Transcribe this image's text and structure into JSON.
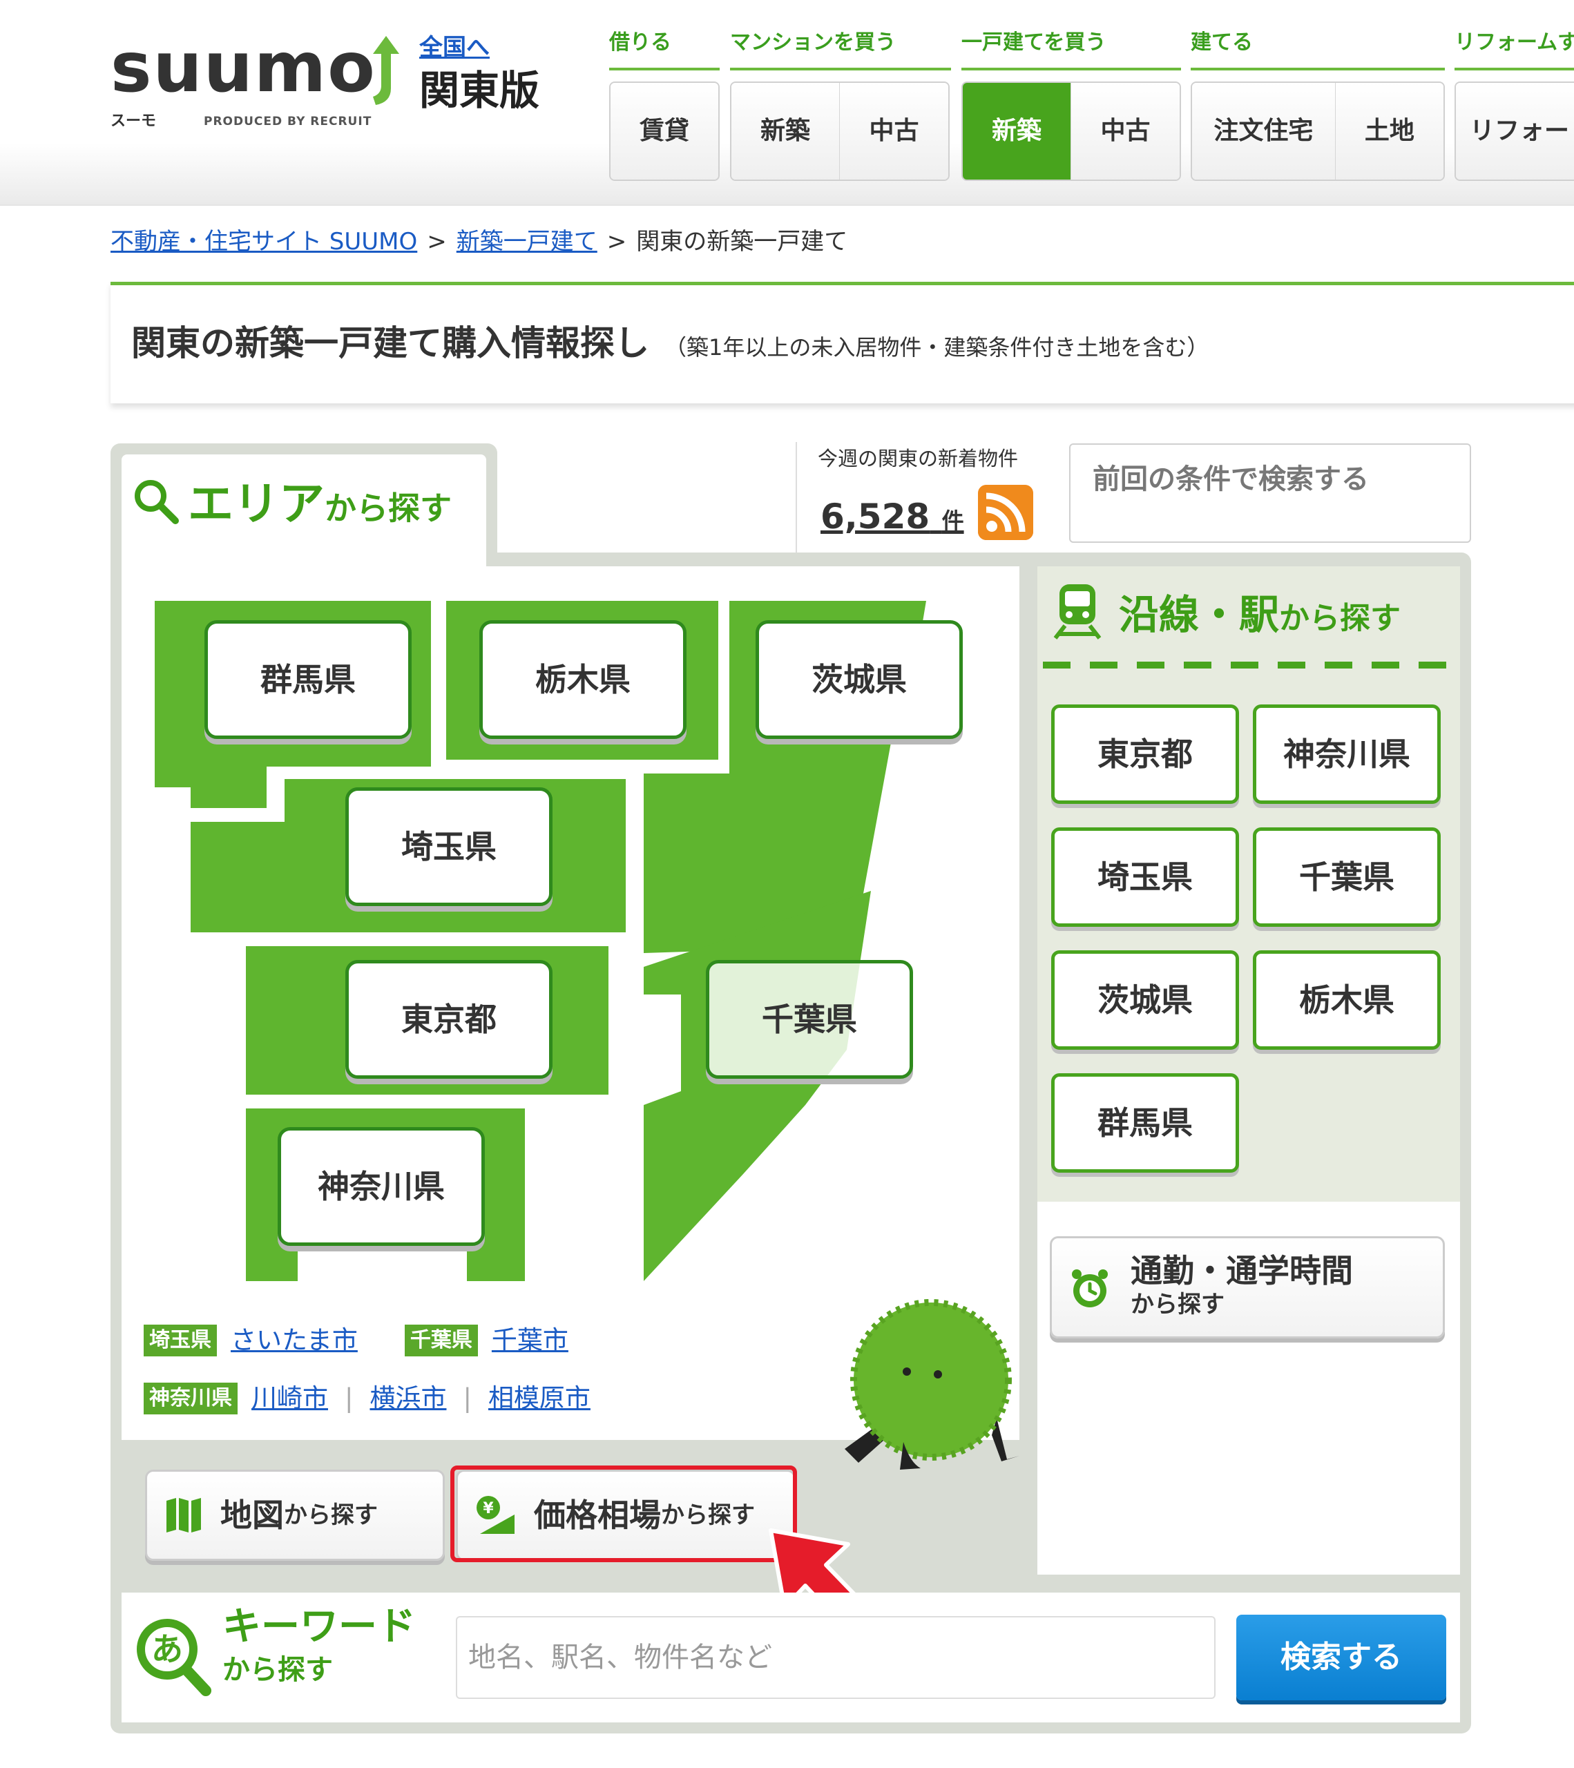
{
  "header": {
    "logo_word": "suumo",
    "logo_kana": "スーモ",
    "logo_produced": "PRODUCED BY RECRUIT",
    "region_link": "全国へ",
    "region_name": "関東版",
    "nav": [
      {
        "category": "借りる",
        "buttons": [
          "賃貸"
        ]
      },
      {
        "category": "マンションを買う",
        "buttons": [
          "新築",
          "中古"
        ]
      },
      {
        "category": "一戸建てを買う",
        "buttons": [
          "新築",
          "中古"
        ],
        "active": "新築"
      },
      {
        "category": "建てる",
        "buttons": [
          "注文住宅",
          "土地"
        ]
      },
      {
        "category": "リフォームす",
        "buttons": [
          "リフォー"
        ]
      }
    ]
  },
  "breadcrumb": {
    "items": [
      "不動産・住宅サイト SUUMO",
      "新築一戸建て",
      "関東の新築一戸建て"
    ],
    "separator": ">"
  },
  "title": {
    "main": "関東の新築一戸建て購入情報探し",
    "sub": "（築1年以上の未入居物件・建築条件付き土地を含む）"
  },
  "area_search": {
    "title_big": "エリア",
    "title_small": "から探す",
    "prefectures": [
      "群馬県",
      "栃木県",
      "茨城県",
      "埼玉県",
      "東京都",
      "千葉県",
      "神奈川県"
    ],
    "city_rows": [
      [
        {
          "tag": "埼玉県",
          "links": [
            "さいたま市"
          ]
        },
        {
          "tag": "千葉県",
          "links": [
            "千葉市"
          ]
        }
      ],
      [
        {
          "tag": "神奈川県",
          "links": [
            "川崎市",
            "横浜市",
            "相模原市"
          ]
        }
      ]
    ],
    "map_button": {
      "big": "地図",
      "small": "から探す"
    },
    "price_button": {
      "big": "価格相場",
      "small": "から探す"
    }
  },
  "new_listings": {
    "label": "今週の関東の新着物件",
    "count": "6,528",
    "unit": "件"
  },
  "prev_search_label": "前回の条件で検索する",
  "line_search": {
    "title_big": "沿線・駅",
    "title_small": "から探す",
    "prefectures": [
      "東京都",
      "神奈川県",
      "埼玉県",
      "千葉県",
      "茨城県",
      "栃木県",
      "群馬県"
    ],
    "commute_title": "通勤・通学時間",
    "commute_sub": "から探す"
  },
  "keyword": {
    "title": "キーワード",
    "sub": "から探す",
    "placeholder": "地名、駅名、物件名など",
    "submit": "検索する"
  },
  "colors": {
    "brand_green": "#48a41d",
    "link_blue": "#1a5bc4",
    "highlight_red": "#e51c2a",
    "search_blue": "#0a7fd1"
  },
  "icons": [
    "suumo-logo-arrow-icon",
    "search-magnifier-icon",
    "rss-icon",
    "train-icon",
    "map-icon",
    "price-yen-icon",
    "clock-icon",
    "keyword-a-magnifier-icon",
    "red-pointer-arrow-icon"
  ]
}
